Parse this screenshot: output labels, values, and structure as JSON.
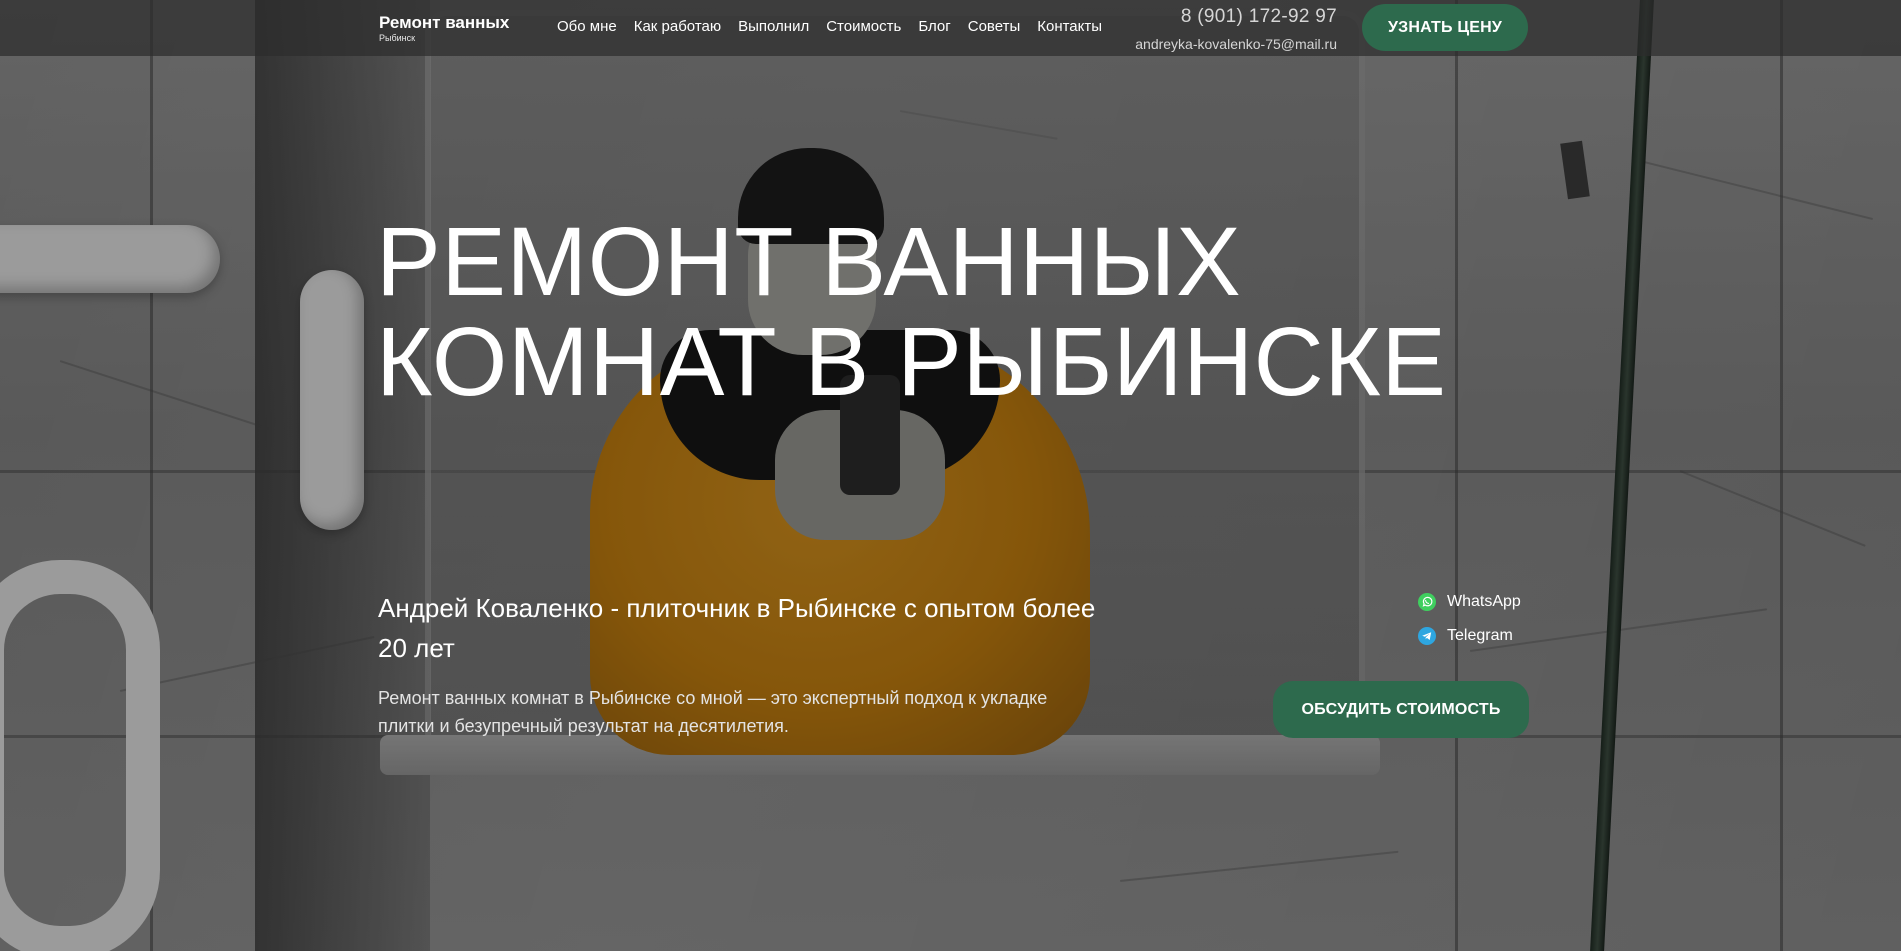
{
  "header": {
    "logo_title": "Ремонт ванных",
    "logo_subtitle": "Рыбинск",
    "nav": [
      {
        "label": "Обо мне"
      },
      {
        "label": "Как работаю"
      },
      {
        "label": "Выполнил"
      },
      {
        "label": "Стоимость"
      },
      {
        "label": "Блог"
      },
      {
        "label": "Советы"
      },
      {
        "label": "Контакты"
      }
    ],
    "phone": "8 (901) 172-92 97",
    "email": "andreyka-kovalenko-75@mail.ru",
    "cta_label": "УЗНАТЬ ЦЕНУ"
  },
  "hero": {
    "title_line1": "РЕМОНТ ВАННЫХ",
    "title_line2": "КОМНАТ В РЫБИНСКЕ",
    "subtitle": "Андрей Коваленко - плиточник в Рыбинске с опытом более 20 лет",
    "description": "Ремонт ванных комнат в Рыбинске со мной — это экспертный подход к укладке плитки и безупречный результат на десятилетия.",
    "messengers": [
      {
        "label": "WhatsApp",
        "icon": "whatsapp-icon",
        "color": "#3fcf5f"
      },
      {
        "label": "Telegram",
        "icon": "telegram-icon",
        "color": "#2ea6e0"
      }
    ],
    "cta_label": "ОБСУДИТЬ СТОИМОСТЬ"
  },
  "colors": {
    "accent": "#2d6a4d",
    "header_bg": "#2d2d2d"
  }
}
